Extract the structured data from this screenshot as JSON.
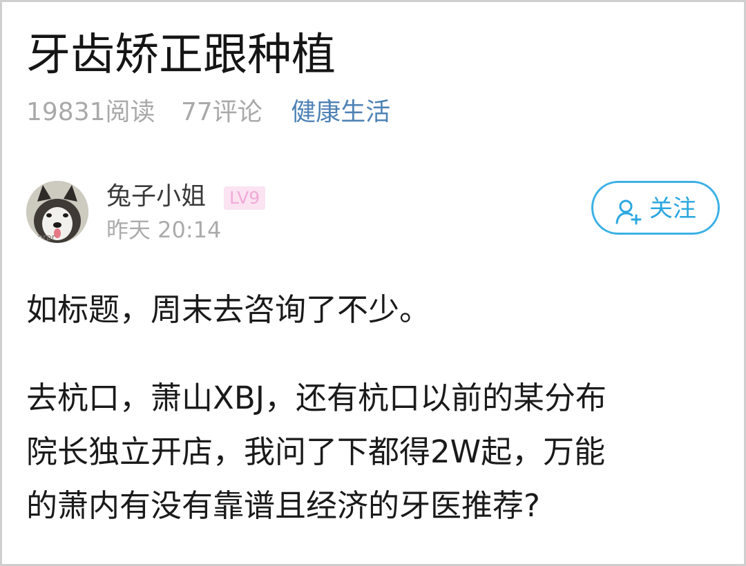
{
  "post": {
    "title": "牙齿矫正跟种植",
    "reads": "19831阅读",
    "comments": "77评论",
    "category": "健康生活"
  },
  "author": {
    "name": "兔子小姐",
    "level": "LV9",
    "time": "昨天 20:14",
    "avatar_icon": "husky-dog-avatar"
  },
  "follow_button": {
    "label": "关注",
    "icon": "user-plus-icon"
  },
  "content": {
    "paragraph1": "如标题，周末去咨询了不少。",
    "paragraph2_lines": [
      "去杭口，萧山XBJ，还有杭口以前的某分布",
      "院长独立开店，我问了下都得2W起，万能",
      "的萧内有没有靠谱且经济的牙医推荐?"
    ]
  },
  "colors": {
    "category": "#4f82b5",
    "follow": "#2aa7e0",
    "level_badge_bg": "#fbe3f2",
    "level_badge_text": "#f2aad7",
    "muted": "#a9a9a9"
  }
}
